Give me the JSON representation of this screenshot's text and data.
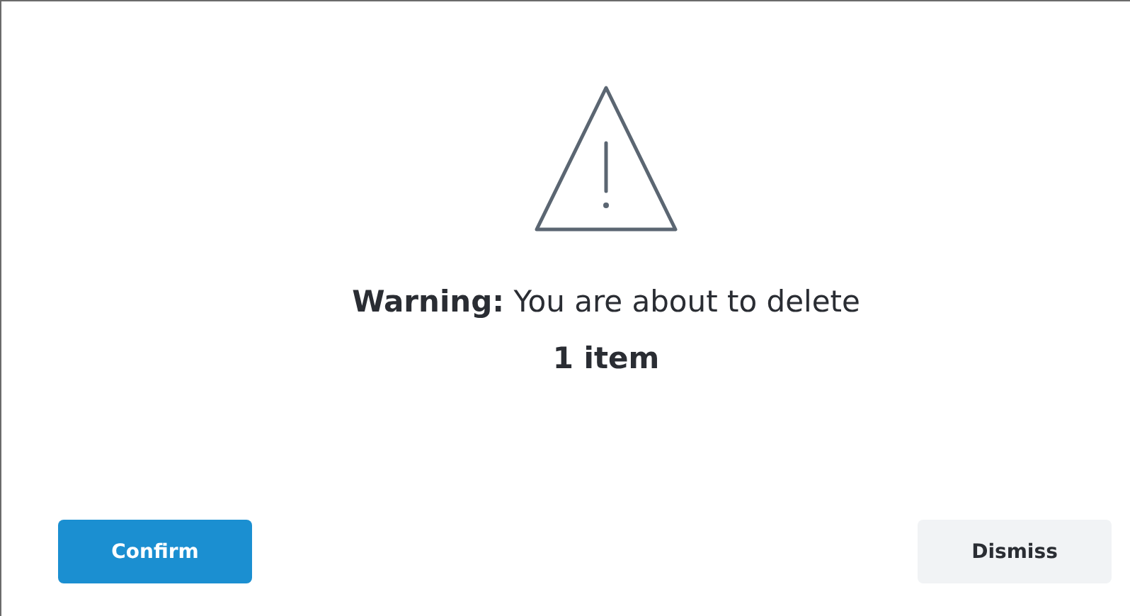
{
  "dialog": {
    "message": "**Warning:** You are about to delete **1 item**",
    "buttons": [
      {
        "label": "Confirm",
        "kind": "primary"
      },
      {
        "label": "Dismiss",
        "kind": "secondary"
      }
    ]
  }
}
